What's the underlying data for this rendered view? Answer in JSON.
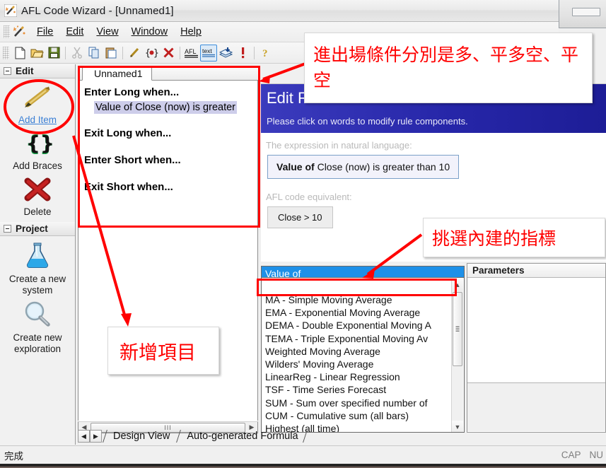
{
  "window": {
    "title": "AFL Code Wizard - [Unnamed1]",
    "app_icon": "wizard-wand-icon"
  },
  "menu": {
    "items": [
      {
        "label": "File",
        "accel": "F"
      },
      {
        "label": "Edit",
        "accel": "E"
      },
      {
        "label": "View",
        "accel": "V"
      },
      {
        "label": "Window",
        "accel": "W"
      },
      {
        "label": "Help",
        "accel": "H"
      }
    ]
  },
  "toolbar": {
    "buttons": [
      {
        "name": "new-icon",
        "glyph": "new"
      },
      {
        "name": "open-icon",
        "glyph": "open"
      },
      {
        "name": "save-icon",
        "glyph": "save"
      },
      {
        "name": "cut-icon",
        "glyph": "cut"
      },
      {
        "name": "copy-icon",
        "glyph": "copy"
      },
      {
        "name": "paste-icon",
        "glyph": "paste"
      },
      {
        "name": "pencil-icon",
        "glyph": "pencil"
      },
      {
        "name": "braces-icon",
        "glyph": "braces"
      },
      {
        "name": "delete-icon",
        "glyph": "delete"
      },
      {
        "name": "afl-icon",
        "glyph": "afl",
        "label": "AFL"
      },
      {
        "name": "text-icon",
        "glyph": "text",
        "label": "text",
        "selected": true
      },
      {
        "name": "export-icon",
        "glyph": "export"
      },
      {
        "name": "alert-icon",
        "glyph": "alert"
      },
      {
        "name": "help-icon",
        "glyph": "help"
      }
    ],
    "overflow_label": "»"
  },
  "sidebar": {
    "groups": [
      {
        "name": "edit",
        "title": "Edit",
        "items": [
          {
            "label": "Add Item",
            "icon": "pencil-icon",
            "is_link": true
          },
          {
            "label": "Add Braces",
            "icon": "braces-icon",
            "is_link": false
          },
          {
            "label": "Delete",
            "icon": "delete-x-icon",
            "is_link": false
          }
        ]
      },
      {
        "name": "project",
        "title": "Project",
        "items": [
          {
            "label": "Create a new system",
            "icon": "flask-icon",
            "is_link": false
          },
          {
            "label": "Create new exploration",
            "icon": "magnifier-icon",
            "is_link": false
          }
        ]
      }
    ]
  },
  "tree_pane": {
    "tab_label": "Unnamed1",
    "rows": [
      {
        "label": "Enter Long when...",
        "child": "Value of Close (now) is greater",
        "child_selected": true
      },
      {
        "label": "Exit Long when...",
        "child": null
      },
      {
        "label": "Enter Short when...",
        "child": null
      },
      {
        "label": "Exit Short when...",
        "child": null
      }
    ],
    "hscroll_grip": "III"
  },
  "rule_editor": {
    "title": "Edit R",
    "subtitle": "Please click on words to modify rule components.",
    "natural_label": "The expression in natural language:",
    "expression_bold": "Value of",
    "expression_rest": " Close (now) is greater than 10",
    "afl_label": "AFL code equivalent:",
    "afl_code": "Close > 10"
  },
  "combobox": {
    "selected_header": "Value of",
    "options": [
      "MA - Simple Moving Average",
      "EMA - Exponential Moving Average",
      "DEMA - Double Exponential Moving A",
      "TEMA - Triple Exponential Moving Av",
      "Weighted Moving Average",
      "Wilders' Moving Average",
      "LinearReg - Linear Regression",
      "TSF - Time Series Forecast",
      "SUM - Sum over specified number of",
      "CUM - Cumulative sum (all bars)",
      "Highest (all time)"
    ],
    "highlighted_index": 0
  },
  "parameters": {
    "header": "Parameters",
    "rows": []
  },
  "view_tabs": {
    "nav_prev": "◀",
    "nav_next": "▶",
    "tabs": [
      {
        "label": "Design View",
        "active": true
      },
      {
        "label": "Auto-generated Formula",
        "active": false
      }
    ]
  },
  "statusbar": {
    "message": "完成",
    "indicators": [
      "CAP",
      "NU"
    ]
  },
  "annotations": [
    {
      "name": "annotation-entry-exit-conditions",
      "text": "進出場條件分別是多、平多空、平空"
    },
    {
      "name": "annotation-pick-builtin-indicator",
      "text": "挑選內建的指標"
    },
    {
      "name": "annotation-add-item",
      "text": "新增項目"
    }
  ],
  "colors": {
    "annotation_red": "#ff0000",
    "rule_header_blue": "#2626a8",
    "combo_highlight_blue": "#1e90e8",
    "tree_selection": "#cdcdea",
    "link_blue": "#3a7fd5"
  }
}
